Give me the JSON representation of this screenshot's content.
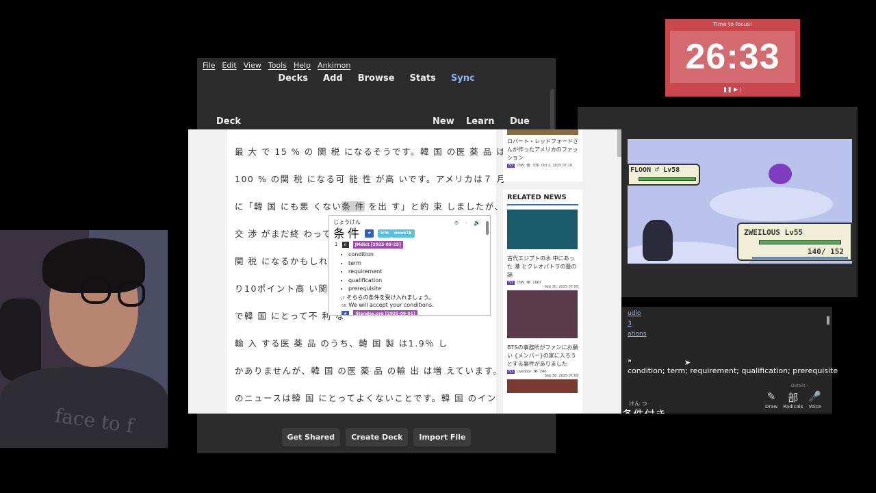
{
  "anki": {
    "menu": [
      "File",
      "Edit",
      "View",
      "Tools",
      "Help",
      "Ankimon"
    ],
    "toolbar": {
      "decks": "Decks",
      "add": "Add",
      "browse": "Browse",
      "stats": "Stats",
      "sync": "Sync"
    },
    "table_head": {
      "deck": "Deck",
      "new": "New",
      "learn": "Learn",
      "due": "Due"
    },
    "buttons": {
      "get_shared": "Get Shared",
      "create_deck": "Create Deck",
      "import_file": "Import File"
    }
  },
  "timer": {
    "label": "Time to focus!",
    "time": "26:33",
    "controls": "❚❚ ▶❘"
  },
  "game": {
    "enemy_name": "FLOON ♂ Lv58",
    "player_name": "ZWEILOUS Lv55",
    "player_hp": "140/ 152"
  },
  "dict_panel": {
    "links": [
      "udio",
      "3",
      "ations"
    ],
    "mark": "a",
    "definitions": "condition; term; requirement; qualification; prerequisite",
    "kana": "けん  つ",
    "word": "条件付き",
    "tools": [
      {
        "glyph": "✎",
        "label": "Draw"
      },
      {
        "glyph": "部",
        "label": "Radicals"
      },
      {
        "glyph": "🎤",
        "label": "Voice"
      }
    ],
    "details": "Details ›"
  },
  "article": {
    "lines": [
      "最 大 で  15    %  の 関 税 になるそうです。韓 国 の医 薬 品 は",
      "100    %   の関 税 になる可 能 性 が高 いです。アメリカは７ 月",
      "に「韓 国 にも悪 くない条  件 を出 す」と約 束 しましたが、",
      "交  渉 がまだ終 わって",
      "関 税 になるかもしれま",
      "り10ポイント高 い関 税",
      "で韓 国 にとって不 利 な",
      "輸 入 する医 薬 品 のうち、韓 国 製 は1.9％                    し",
      "かありませんが、韓 国 の医 薬 品 の輸 出 は増 えています。こ",
      "のニュースは韓 国 にとってよくないことです。韓 国 のイン"
    ],
    "highlight": "条  件"
  },
  "sidebar": {
    "top_card": {
      "title": "ロバート・レッドフォードさんが作ったアメリカのファッション",
      "level": "N3",
      "source": "CNN",
      "views": "330",
      "date": "Oct 2, 2025 07:10"
    },
    "related_title": "RELATED NEWS",
    "cards": [
      {
        "title": "古代エジプトの水 中にあった 港 とクレオパトラの墓の謎",
        "level": "N3",
        "source": "CNN",
        "views": "1667",
        "date": "Sep 30, 2025 07:09"
      },
      {
        "title": "BTSの事務所がファンにお願い {メンバー}の家に入ろうとする事件がありました",
        "level": "N3",
        "source": "Livedoor",
        "views": "240",
        "date": "Sep 30, 2025 07:09"
      }
    ]
  },
  "popup": {
    "reading": "じょうけん",
    "term": "条件",
    "tags": [
      "★",
      "ichi",
      "news1k"
    ],
    "entry_num": "1",
    "entry_num_tag": "n",
    "dict_name": "JMdict [2025-09-25]",
    "glosses": [
      "condition",
      "term",
      "requirement",
      "qualification",
      "prerequisite"
    ],
    "example_jp": "そちらの条件を受け入れましょう。",
    "example_en": "We will accept your conditions.",
    "dict2": "Jitendex.org [2025-09-01]"
  }
}
